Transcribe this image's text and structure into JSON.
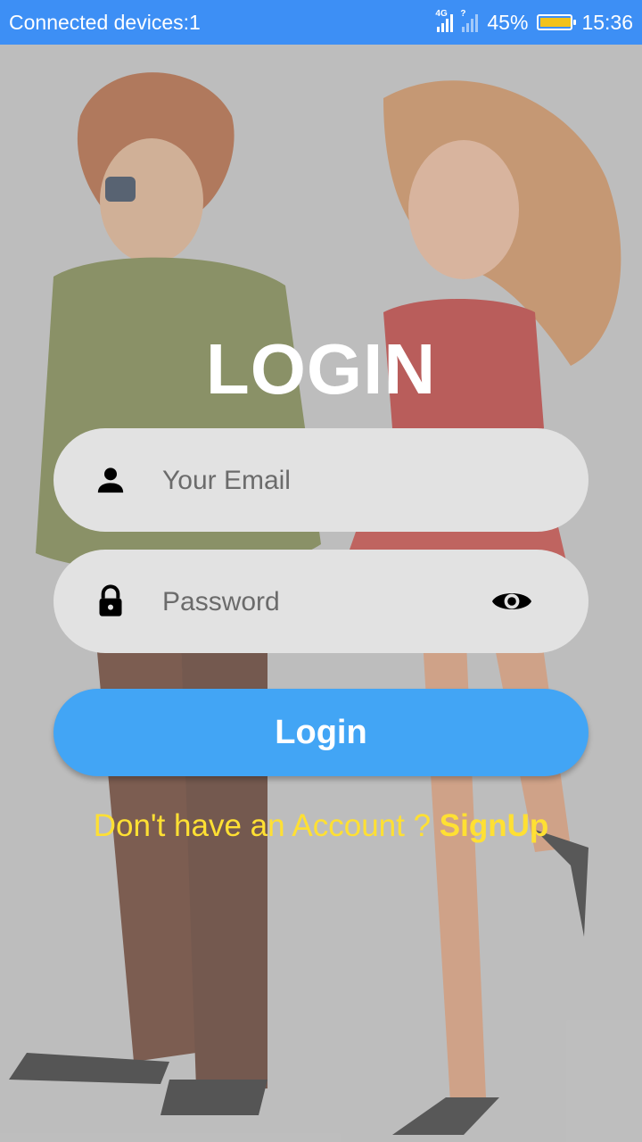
{
  "status_bar": {
    "left_text": "Connected devices:1",
    "network_label": "4G",
    "sim2_label": "?",
    "battery_percent": "45%",
    "battery_level": 0.45,
    "time": "15:36",
    "color": "#3d8ff5"
  },
  "login": {
    "title": "LOGIN",
    "email_placeholder": "Your Email",
    "password_placeholder": "Password",
    "button_label": "Login",
    "no_account_text": "Don't have an Account ? ",
    "signup_label": "SignUp",
    "accent": "#42a5f5",
    "link_color": "#ffe033"
  },
  "icons": {
    "email": "person-icon",
    "password": "lock-icon",
    "toggle": "eye-icon"
  }
}
